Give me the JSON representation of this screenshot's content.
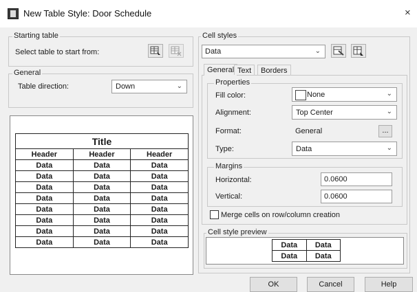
{
  "window": {
    "title": "New Table Style: Door Schedule",
    "close_glyph": "×"
  },
  "starting_table": {
    "group_label": "Starting table",
    "prompt": "Select table to start from:"
  },
  "general": {
    "group_label": "General",
    "direction_label": "Table direction:",
    "direction_value": "Down"
  },
  "preview": {
    "title": "Title",
    "headers": [
      "Header",
      "Header",
      "Header"
    ],
    "rows": [
      [
        "Data",
        "Data",
        "Data"
      ],
      [
        "Data",
        "Data",
        "Data"
      ],
      [
        "Data",
        "Data",
        "Data"
      ],
      [
        "Data",
        "Data",
        "Data"
      ],
      [
        "Data",
        "Data",
        "Data"
      ],
      [
        "Data",
        "Data",
        "Data"
      ],
      [
        "Data",
        "Data",
        "Data"
      ],
      [
        "Data",
        "Data",
        "Data"
      ]
    ]
  },
  "cell_styles": {
    "group_label": "Cell styles",
    "selected": "Data",
    "tabs": [
      "General",
      "Text",
      "Borders"
    ],
    "properties": {
      "group_label": "Properties",
      "fill_color_label": "Fill color:",
      "fill_color_value": "None",
      "alignment_label": "Alignment:",
      "alignment_value": "Top Center",
      "format_label": "Format:",
      "format_value": "General",
      "format_button": "...",
      "type_label": "Type:",
      "type_value": "Data"
    },
    "margins": {
      "group_label": "Margins",
      "horizontal_label": "Horizontal:",
      "horizontal_value": "0.0600",
      "vertical_label": "Vertical:",
      "vertical_value": "0.0600"
    },
    "merge_label": "Merge cells on row/column creation",
    "style_preview": {
      "group_label": "Cell style preview",
      "cells": [
        [
          "Data",
          "Data"
        ],
        [
          "Data",
          "Data"
        ]
      ]
    }
  },
  "buttons": {
    "ok": "OK",
    "cancel": "Cancel",
    "help": "Help"
  }
}
